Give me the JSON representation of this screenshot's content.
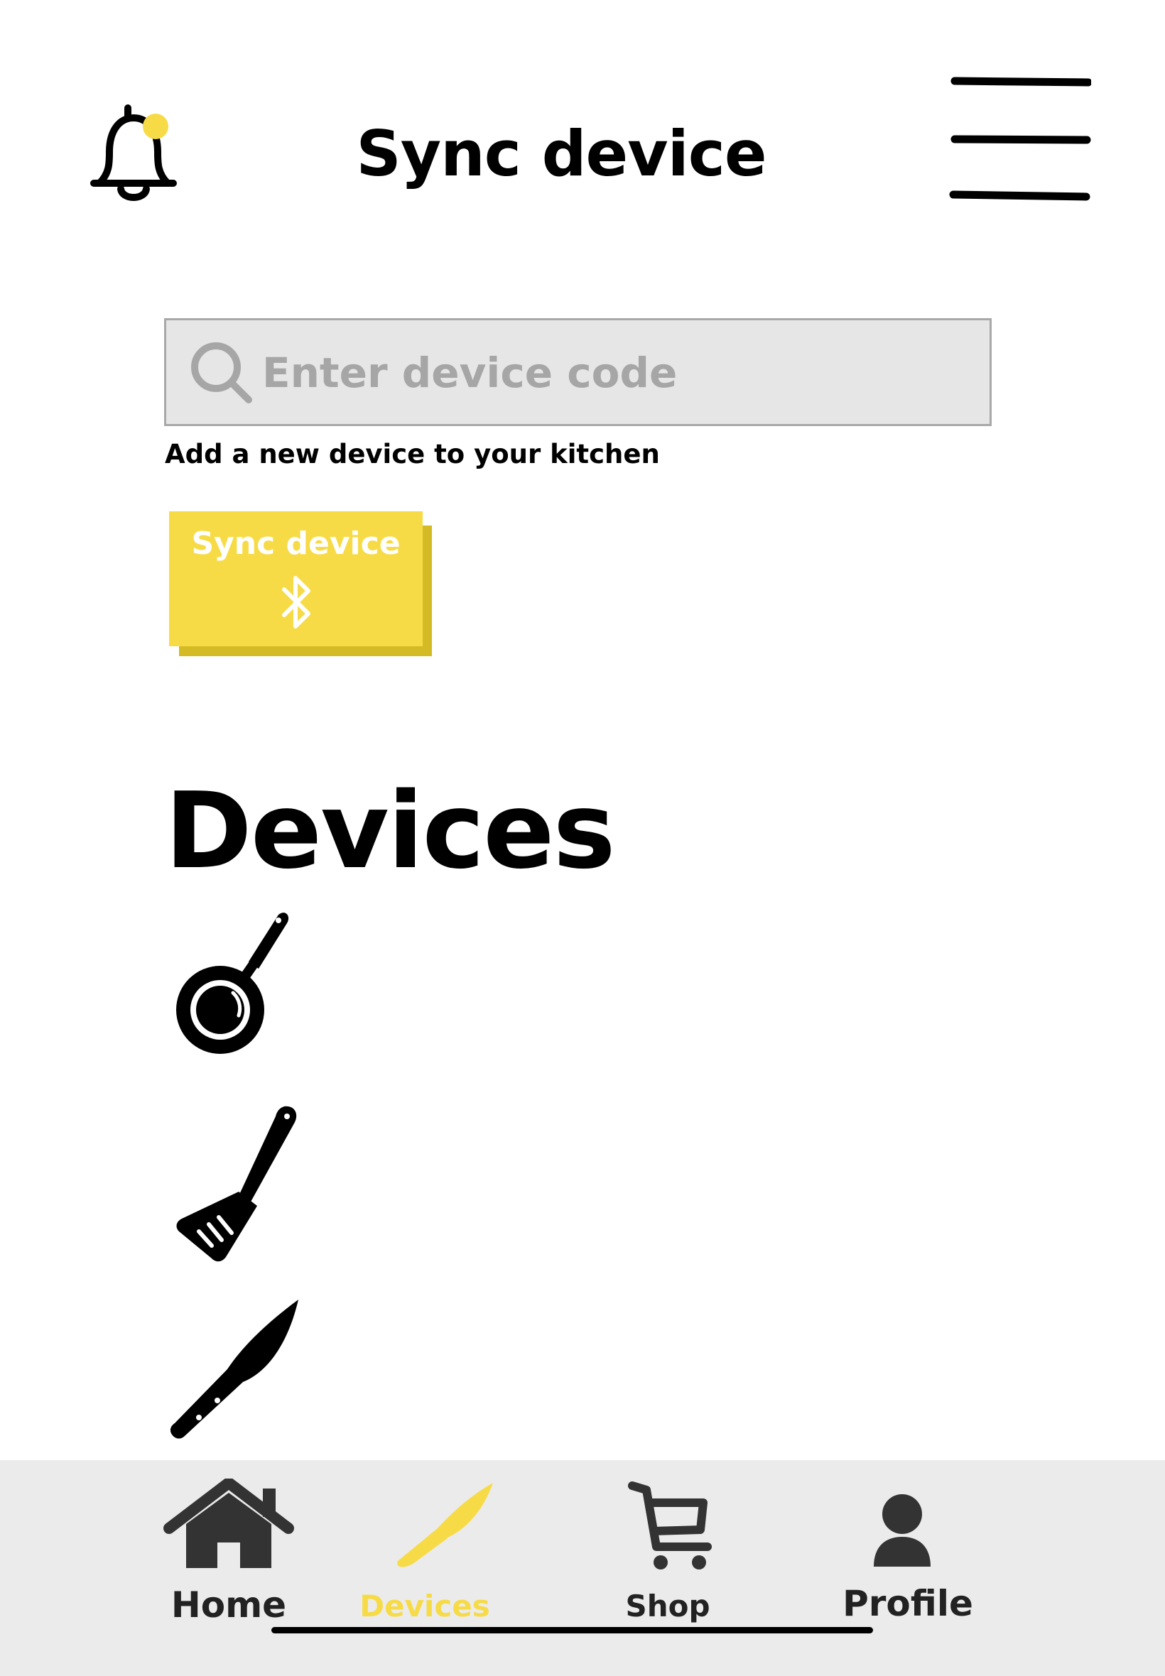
{
  "header": {
    "title": "Sync device",
    "notification_dot_color": "#f7db46"
  },
  "search": {
    "placeholder": "Enter device code"
  },
  "helper_text": "Add a new device to your kitchen",
  "sync_button": {
    "label": "Sync device",
    "icon": "bluetooth-icon",
    "color": "#f7db46"
  },
  "devices": {
    "heading": "Devices",
    "items": [
      {
        "icon": "frying-pan-icon"
      },
      {
        "icon": "spatula-icon"
      },
      {
        "icon": "knife-icon"
      }
    ]
  },
  "bottom_nav": {
    "items": [
      {
        "label": "Home",
        "icon": "home-icon",
        "active": false
      },
      {
        "label": "Devices",
        "icon": "knife-icon",
        "active": true
      },
      {
        "label": "Shop",
        "icon": "cart-icon",
        "active": false
      },
      {
        "label": "Profile",
        "icon": "user-icon",
        "active": false
      }
    ],
    "active_color": "#f7db46"
  }
}
